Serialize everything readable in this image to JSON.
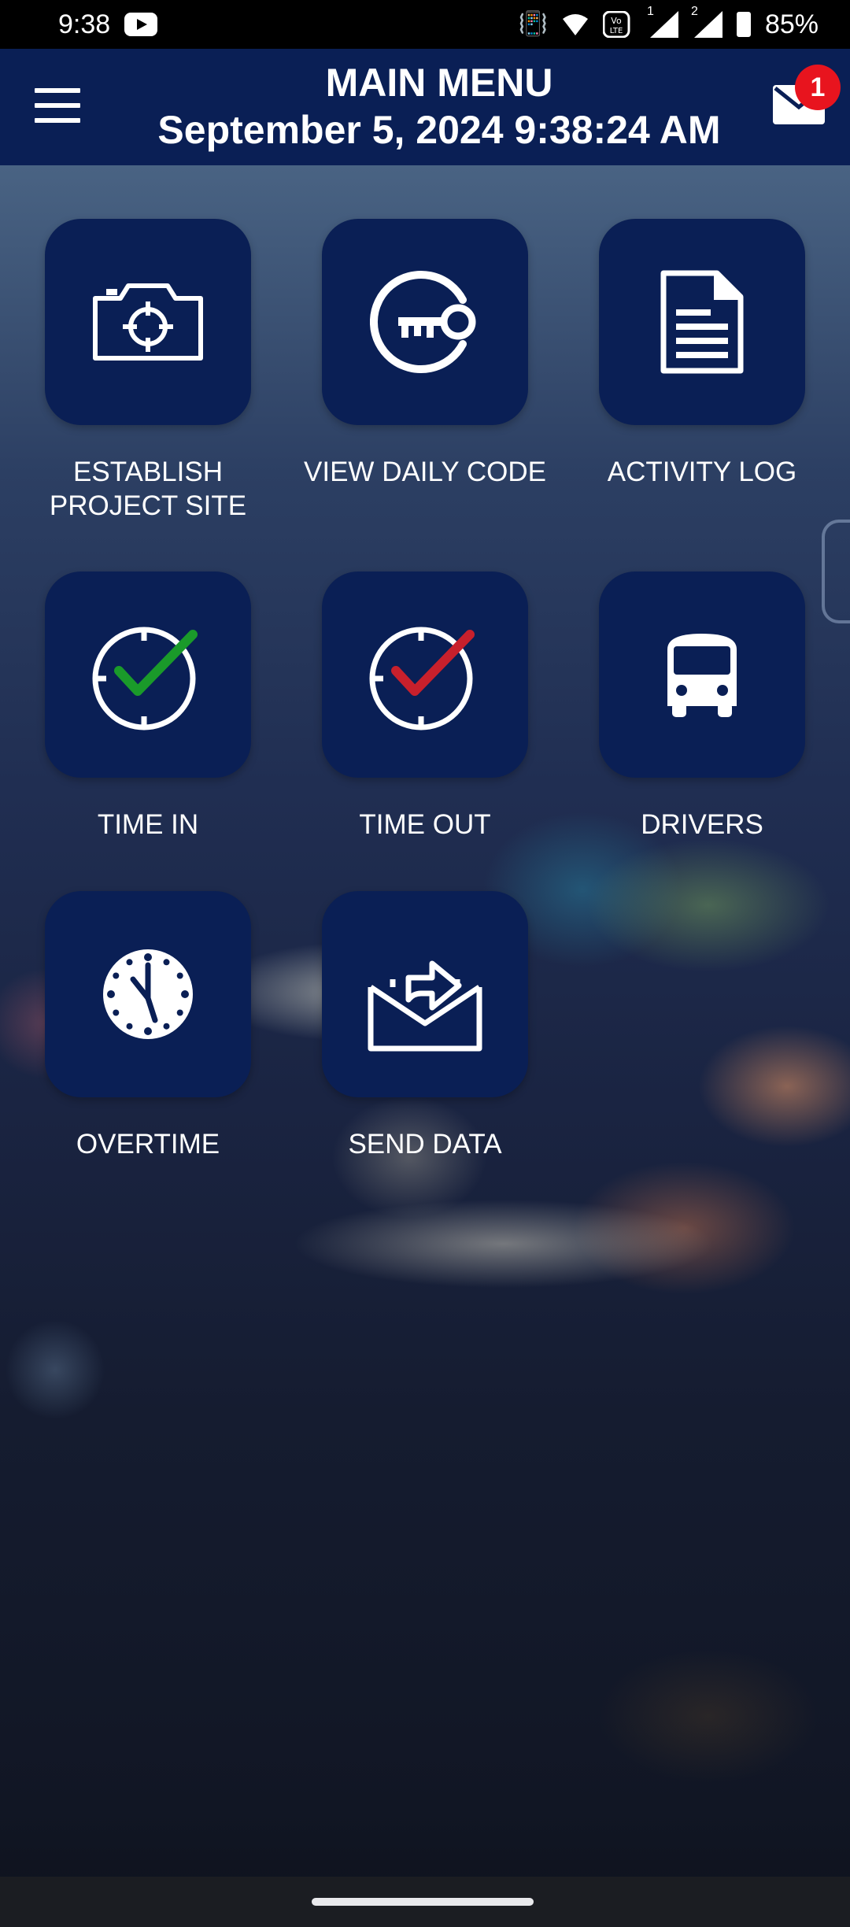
{
  "status_bar": {
    "time": "9:38",
    "battery": "85%",
    "icons": [
      "youtube-icon",
      "vibrate-icon",
      "wifi-icon",
      "volte-icon",
      "signal-icon",
      "signal-icon",
      "battery-icon"
    ],
    "sim1": "1",
    "sim2": "2"
  },
  "header": {
    "title": "MAIN MENU",
    "datetime": "September 5, 2024 9:38:24 AM",
    "mail_badge": "1",
    "background": "#0a1f55"
  },
  "menu": {
    "items": [
      {
        "label": "ESTABLISH\nPROJECT SITE",
        "icon": "camera-target-icon"
      },
      {
        "label": "VIEW DAILY CODE",
        "icon": "key-icon"
      },
      {
        "label": "ACTIVITY LOG",
        "icon": "document-icon"
      },
      {
        "label": "TIME IN",
        "icon": "clock-check-green-icon",
        "accent": "#1a9a2a"
      },
      {
        "label": "TIME OUT",
        "icon": "clock-check-red-icon",
        "accent": "#c8202c"
      },
      {
        "label": "DRIVERS",
        "icon": "bus-icon"
      },
      {
        "label": "OVERTIME",
        "icon": "clock-icon"
      },
      {
        "label": "SEND DATA",
        "icon": "send-mail-icon"
      }
    ]
  }
}
